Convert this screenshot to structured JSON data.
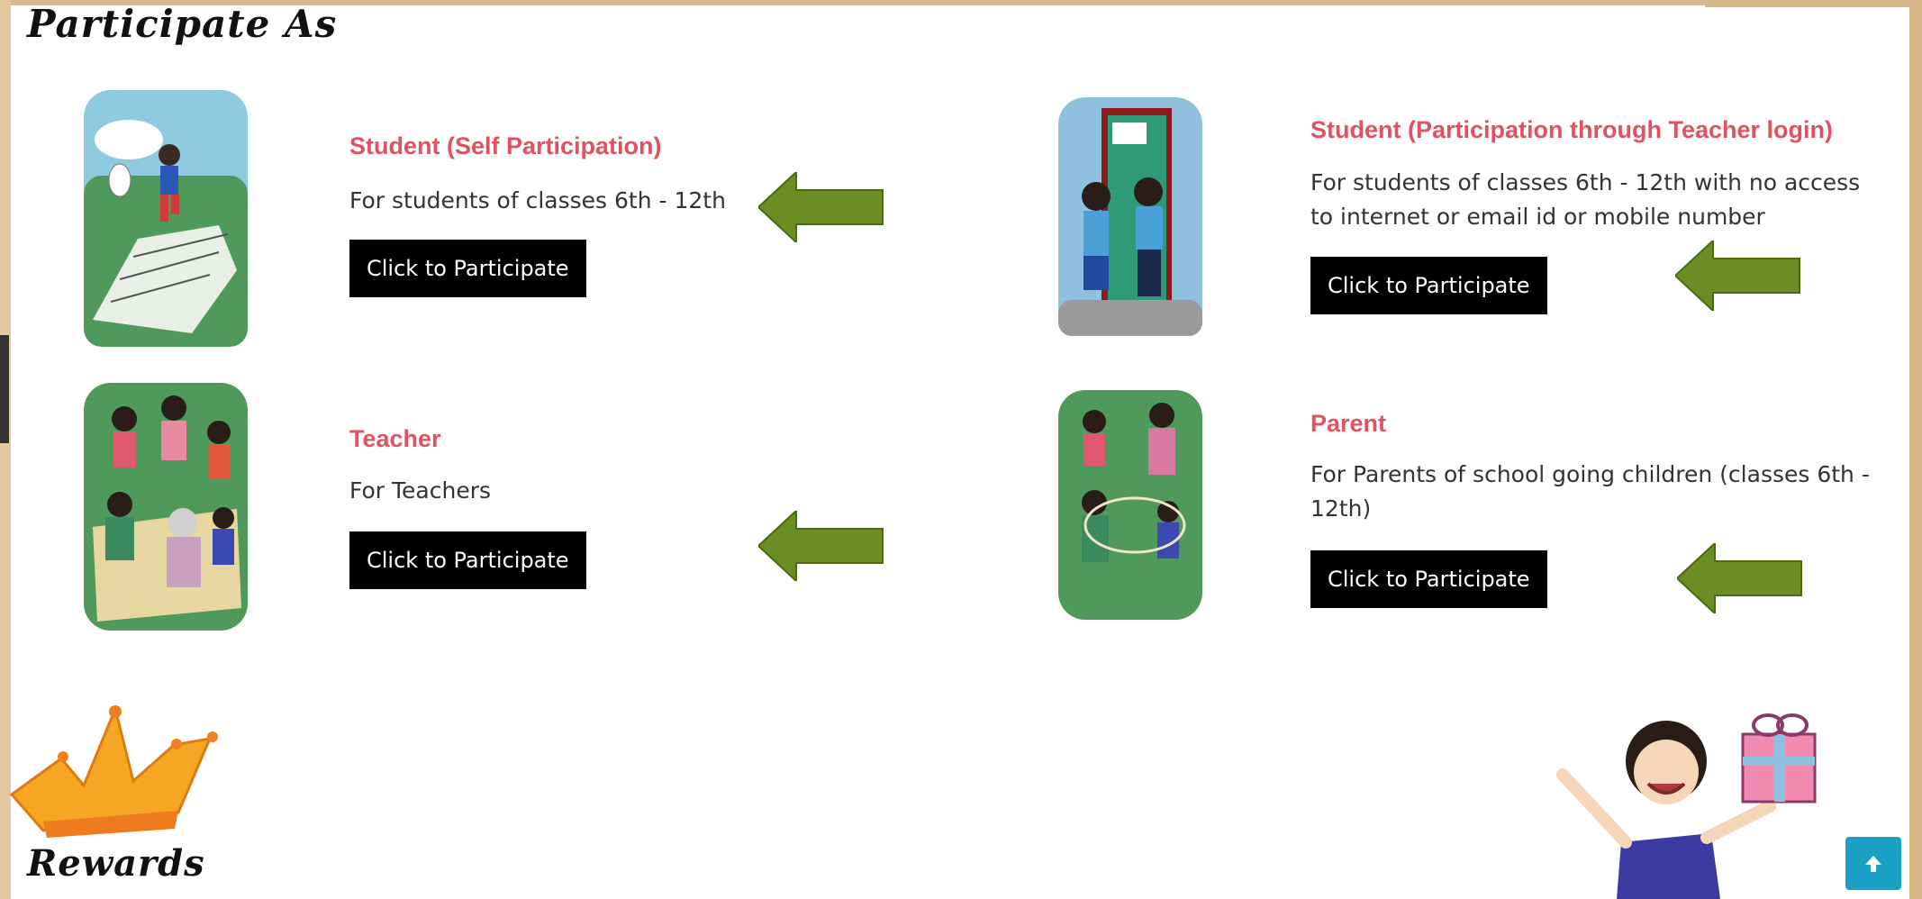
{
  "page": {
    "section_title": "Participate As",
    "rewards_title": "Rewards"
  },
  "cards": [
    {
      "title": "Student (Self Participation)",
      "description": "For students of classes 6th - 12th",
      "button_label": "Click to Participate"
    },
    {
      "title": "Student (Participation through Teacher login)",
      "description": "For students of classes 6th - 12th with no access to internet or email id or mobile number",
      "button_label": "Click to Participate"
    },
    {
      "title": "Teacher",
      "description": "For Teachers",
      "button_label": "Click to Participate"
    },
    {
      "title": "Parent",
      "description": "For Parents of school going children (classes 6th - 12th)",
      "button_label": "Click to Participate"
    }
  ],
  "colors": {
    "title_accent": "#e05262",
    "arrow": "#6b8e23",
    "button_bg": "#000000",
    "scroll_top_bg": "#1aa0c4"
  },
  "icons": {
    "arrow": "left-arrow-icon",
    "scroll_top": "arrow-up-icon",
    "crown": "crown-icon"
  }
}
